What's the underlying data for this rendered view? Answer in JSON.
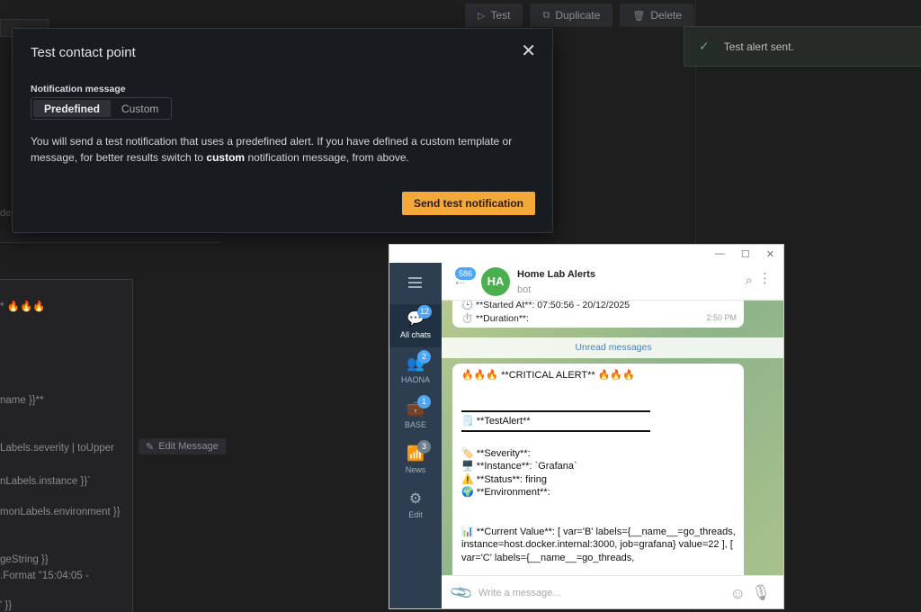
{
  "toolbar": {
    "test_label": "Test",
    "duplicate_label": "Duplicate",
    "delete_label": "Delete"
  },
  "toast": {
    "message": "Test alert sent."
  },
  "background": {
    "ghost_text": "de",
    "editor_lines": [
      "* 🔥🔥🔥",
      "name }}**",
      "Labels.severity | toUpper",
      "nLabels.instance }}`",
      "monLabels.environment }}",
      "geString }}",
      ".Format \"15:04:05 -",
      "' }}"
    ],
    "edit_message_label": "Edit Message"
  },
  "modal": {
    "title": "Test contact point",
    "close_glyph": "✕",
    "field_label": "Notification message",
    "options": [
      "Predefined",
      "Custom"
    ],
    "selected_option": "Predefined",
    "description_part1": "You will send a test notification that uses a predefined alert. If you have defined a custom template or message, for better results switch to ",
    "description_bold": "custom",
    "description_part2": " notification message, from above.",
    "send_label": "Send test notification"
  },
  "telegram": {
    "window_controls": [
      "—",
      "☐",
      "✕"
    ],
    "folders": [
      {
        "label": "All chats",
        "badge": "12"
      },
      {
        "label": "HAONA",
        "badge": "2"
      },
      {
        "label": "BASE",
        "badge": "1"
      },
      {
        "label": "News",
        "badge": "3"
      },
      {
        "label": "Edit",
        "badge": ""
      }
    ],
    "back_badge": "586",
    "avatar_initials": "HA",
    "chat_name": "Home Lab Alerts",
    "chat_status": "bot",
    "prev_message": {
      "line1": "🕒 **Started At**: 07:50:56 - 20/12/2025",
      "line2": "⏱️ **Duration**:",
      "time": "2:50 PM"
    },
    "unread_label": "Unread messages",
    "message_lines": {
      "header": "🔥🔥🔥 **CRITICAL ALERT** 🔥🔥🔥",
      "alert_name": "🗒️ **TestAlert**",
      "severity": "🏷️ **Severity**:",
      "instance": "🖥️ **Instance**: `Grafana`",
      "status": "⚠️ **Status**: firing",
      "environment": "🌍 **Environment**:",
      "value1": "📊 **Current Value**: [ var='B' labels={__name__=go_threads,",
      "value2": "instance=host.docker.internal:3000, job=grafana} value=22 ], [",
      "value3": "var='C' labels={__name__=go_threads,"
    },
    "input_placeholder": "Write a message..."
  }
}
